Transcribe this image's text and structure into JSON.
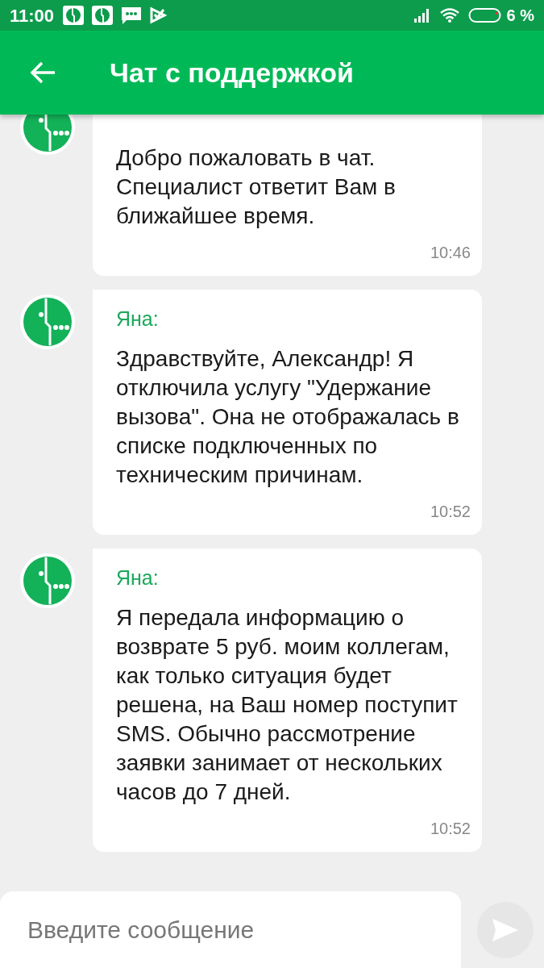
{
  "status_bar": {
    "time": "11:00",
    "battery": "6 %"
  },
  "header": {
    "title": "Чат с поддержкой"
  },
  "messages": [
    {
      "text": "Добро пожаловать в чат. Специалист ответит Вам в ближайшее время.",
      "time": "10:46"
    },
    {
      "sender": "Яна:",
      "text": "Здравствуйте, Александр! Я отключила услугу \"Удержание вызова\". Она не отображалась в списке подключенных по техническим причинам.",
      "time": "10:52"
    },
    {
      "sender": "Яна:",
      "text": "Я передала информацию о возврате 5 руб. моим коллегам, как только ситуация будет решена, на Ваш номер поступит SMS. Обычно рассмотрение заявки занимает от нескольких часов до 7 дней.",
      "time": "10:52"
    }
  ],
  "composer": {
    "placeholder": "Введите сообщение"
  }
}
